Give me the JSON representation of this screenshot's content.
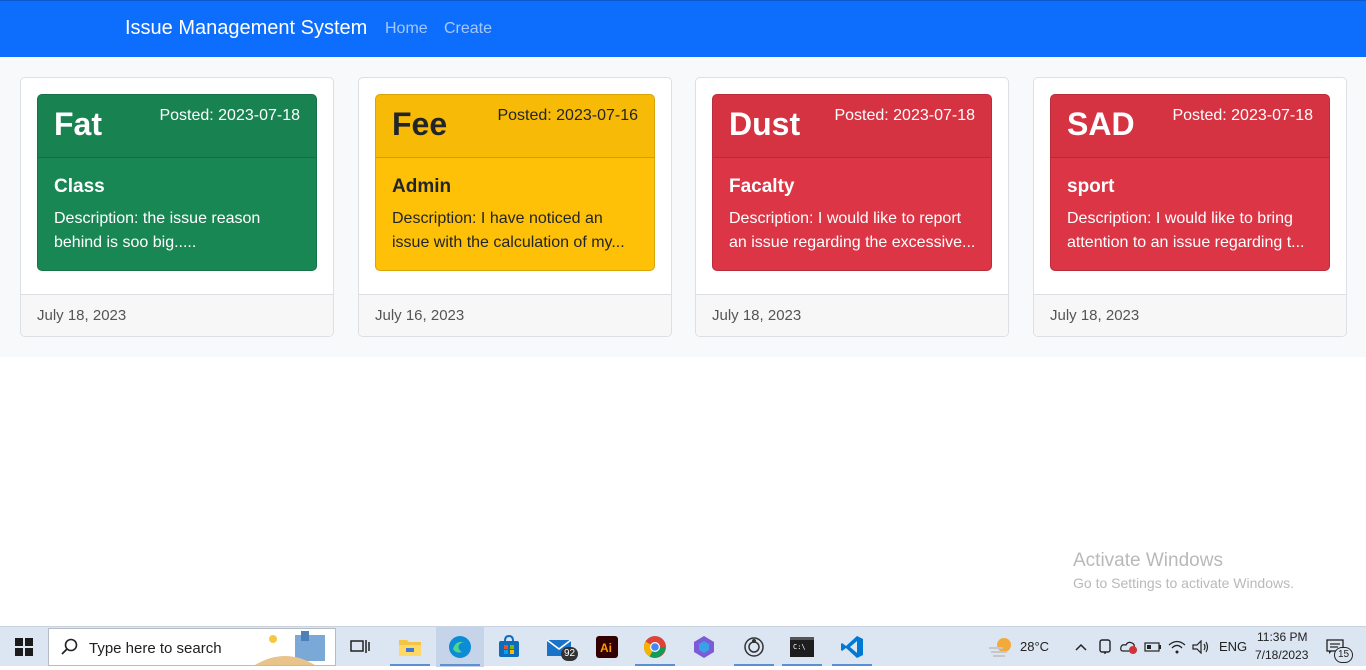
{
  "navbar": {
    "brand": "Issue Management System",
    "links": [
      "Home",
      "Create"
    ],
    "color": "#0d6efd"
  },
  "cards": [
    {
      "title": "Fat",
      "posted": "Posted: 2023-07-18",
      "category": "Class",
      "description": "Description: the issue reason behind is soo big.....",
      "date": "July 18, 2023",
      "status_color": "#198754"
    },
    {
      "title": "Fee",
      "posted": "Posted: 2023-07-16",
      "category": "Admin",
      "description": "Description: I have noticed an issue with the calculation of my...",
      "date": "July 16, 2023",
      "status_color": "#ffc107"
    },
    {
      "title": "Dust",
      "posted": "Posted: 2023-07-18",
      "category": "Facalty",
      "description": "Description: I would like to report an issue regarding the excessive...",
      "date": "July 18, 2023",
      "status_color": "#dc3545"
    },
    {
      "title": "SAD",
      "posted": "Posted: 2023-07-18",
      "category": "sport",
      "description": "Description: I would like to bring attention to an issue regarding t...",
      "date": "July 18, 2023",
      "status_color": "#dc3545"
    }
  ],
  "watermark": {
    "title": "Activate Windows",
    "subtitle": "Go to Settings to activate Windows."
  },
  "taskbar": {
    "search_placeholder": "Type here to search",
    "mail_badge": "92",
    "weather": "28°C",
    "language": "ENG",
    "time": "11:36 PM",
    "date": "7/18/2023",
    "notification_count": "15",
    "icons": [
      "windows-start-icon",
      "search-icon",
      "task-view-icon",
      "file-explorer-icon",
      "edge-icon",
      "store-icon",
      "mail-icon",
      "illustrator-icon",
      "chrome-icon",
      "copilot-icon",
      "sync-icon",
      "terminal-icon",
      "vscode-icon"
    ]
  }
}
